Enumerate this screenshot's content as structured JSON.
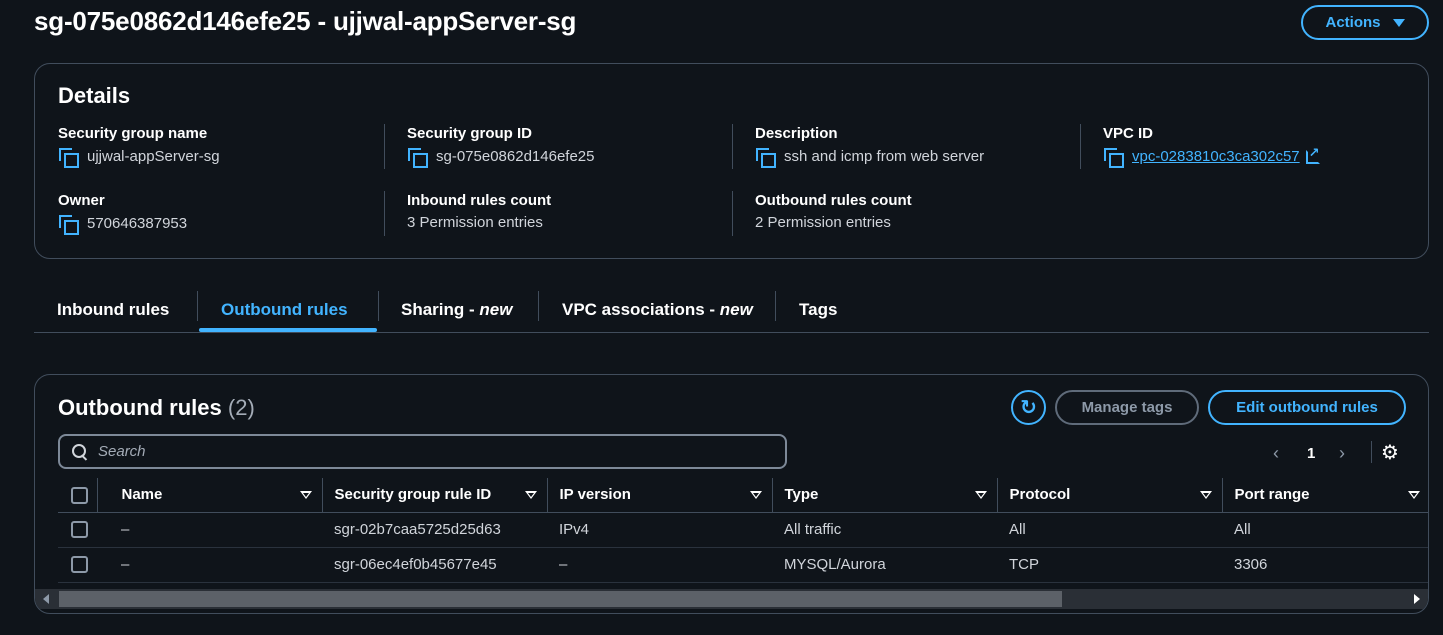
{
  "page": {
    "title": "sg-075e0862d146efe25 - ujjwal-appServer-sg",
    "actions_label": "Actions"
  },
  "details": {
    "title": "Details",
    "fields": {
      "sg_name": {
        "label": "Security group name",
        "value": "ujjwal-appServer-sg"
      },
      "sg_id": {
        "label": "Security group ID",
        "value": "sg-075e0862d146efe25"
      },
      "description": {
        "label": "Description",
        "value": "ssh and icmp from web server"
      },
      "vpc_id": {
        "label": "VPC ID",
        "value": "vpc-0283810c3ca302c57"
      },
      "owner": {
        "label": "Owner",
        "value": "570646387953"
      },
      "inbound_count": {
        "label": "Inbound rules count",
        "value": "3 Permission entries"
      },
      "outbound_count": {
        "label": "Outbound rules count",
        "value": "2 Permission entries"
      }
    }
  },
  "tabs": [
    {
      "label": "Inbound rules",
      "suffix": ""
    },
    {
      "label": "Outbound rules",
      "suffix": ""
    },
    {
      "label": "Sharing - ",
      "suffix": "new"
    },
    {
      "label": "VPC associations - ",
      "suffix": "new"
    },
    {
      "label": "Tags",
      "suffix": ""
    }
  ],
  "rules": {
    "title": "Outbound rules",
    "count": "(2)",
    "manage_tags_label": "Manage tags",
    "edit_label": "Edit outbound rules",
    "search_placeholder": "Search",
    "page_number": "1",
    "columns": [
      "Name",
      "Security group rule ID",
      "IP version",
      "Type",
      "Protocol",
      "Port range"
    ],
    "rows": [
      {
        "name": "–",
        "rule_id": "sgr-02b7caa5725d25d63",
        "ip_version": "IPv4",
        "type": "All traffic",
        "protocol": "All",
        "port_range": "All"
      },
      {
        "name": "–",
        "rule_id": "sgr-06ec4ef0b45677e45",
        "ip_version": "–",
        "type": "MYSQL/Aurora",
        "protocol": "TCP",
        "port_range": "3306"
      }
    ]
  },
  "colors": {
    "accent": "#42b4ff",
    "background": "#0f141a",
    "border": "#414d5c"
  }
}
